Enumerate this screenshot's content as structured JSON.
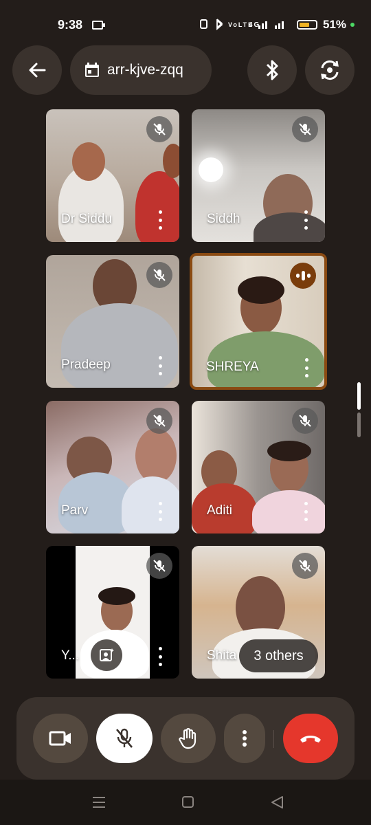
{
  "status_bar": {
    "time": "9:38",
    "signal_text": "Vo LTE ⁴⁶",
    "battery_percent": "51%",
    "battery_level": 0.51
  },
  "header": {
    "meeting_code": "arr-kjve-zqq"
  },
  "participants": [
    {
      "name": "Dr Siddu",
      "muted": true
    },
    {
      "name": "Siddh",
      "muted": true
    },
    {
      "name": "Pradeep",
      "muted": true
    },
    {
      "name": "SHREYA",
      "muted": false,
      "speaking": true
    },
    {
      "name": "Parv",
      "muted": true
    },
    {
      "name": "Aditi",
      "muted": true
    },
    {
      "name": "Y...",
      "muted": true
    },
    {
      "name": "Shita",
      "muted": true
    }
  ],
  "others_chip": {
    "label": "3 others"
  },
  "colors": {
    "end_call": "#e5372c",
    "active_border": "#8a4a12",
    "panel": "#3a322d"
  }
}
